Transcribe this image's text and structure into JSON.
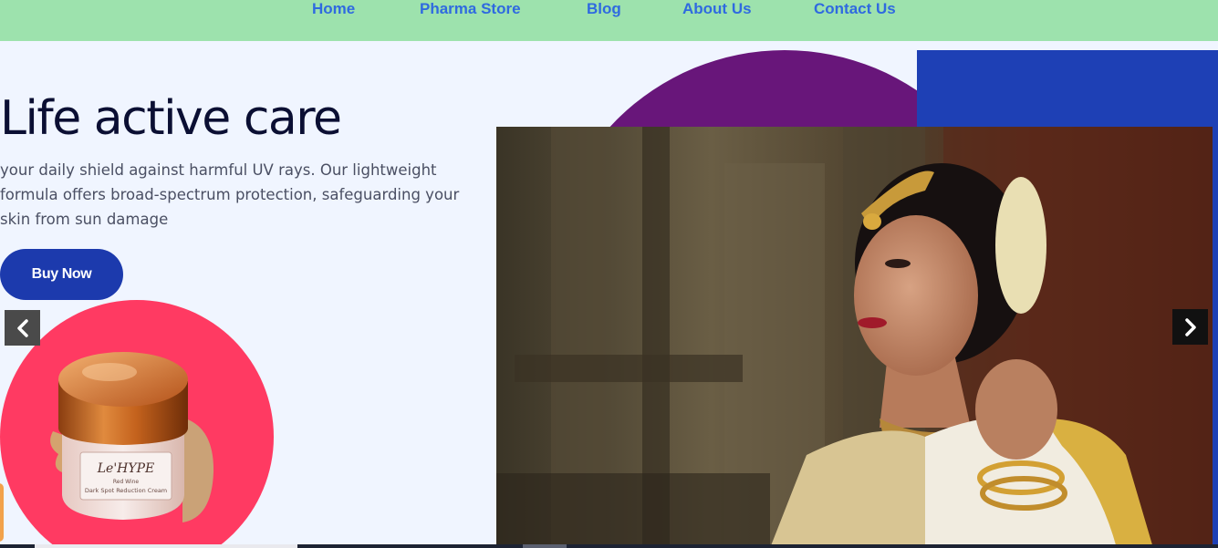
{
  "nav": {
    "items": [
      {
        "label": "Home"
      },
      {
        "label": "Pharma Store"
      },
      {
        "label": "Blog"
      },
      {
        "label": "About Us"
      },
      {
        "label": "Contact Us"
      }
    ]
  },
  "hero": {
    "title": "Life active care",
    "description": "your daily shield against harmful UV rays. Our lightweight formula offers broad-spectrum protection, safeguarding your skin from sun damage",
    "cta_label": "Buy Now"
  },
  "product": {
    "brand": "Le'HYPE",
    "line1": "Red Wine",
    "line2": "Dark Spot Reduction Cream"
  },
  "carousel": {
    "prev_icon": "chevron-left-icon",
    "next_icon": "chevron-right-icon"
  },
  "colors": {
    "nav_bg": "#9de2ad",
    "nav_link": "#2f6ae0",
    "cta_bg": "#1c3aad",
    "product_circle": "#ff3a62",
    "accent_purple": "#68167a",
    "accent_blue": "#1e40b5"
  }
}
